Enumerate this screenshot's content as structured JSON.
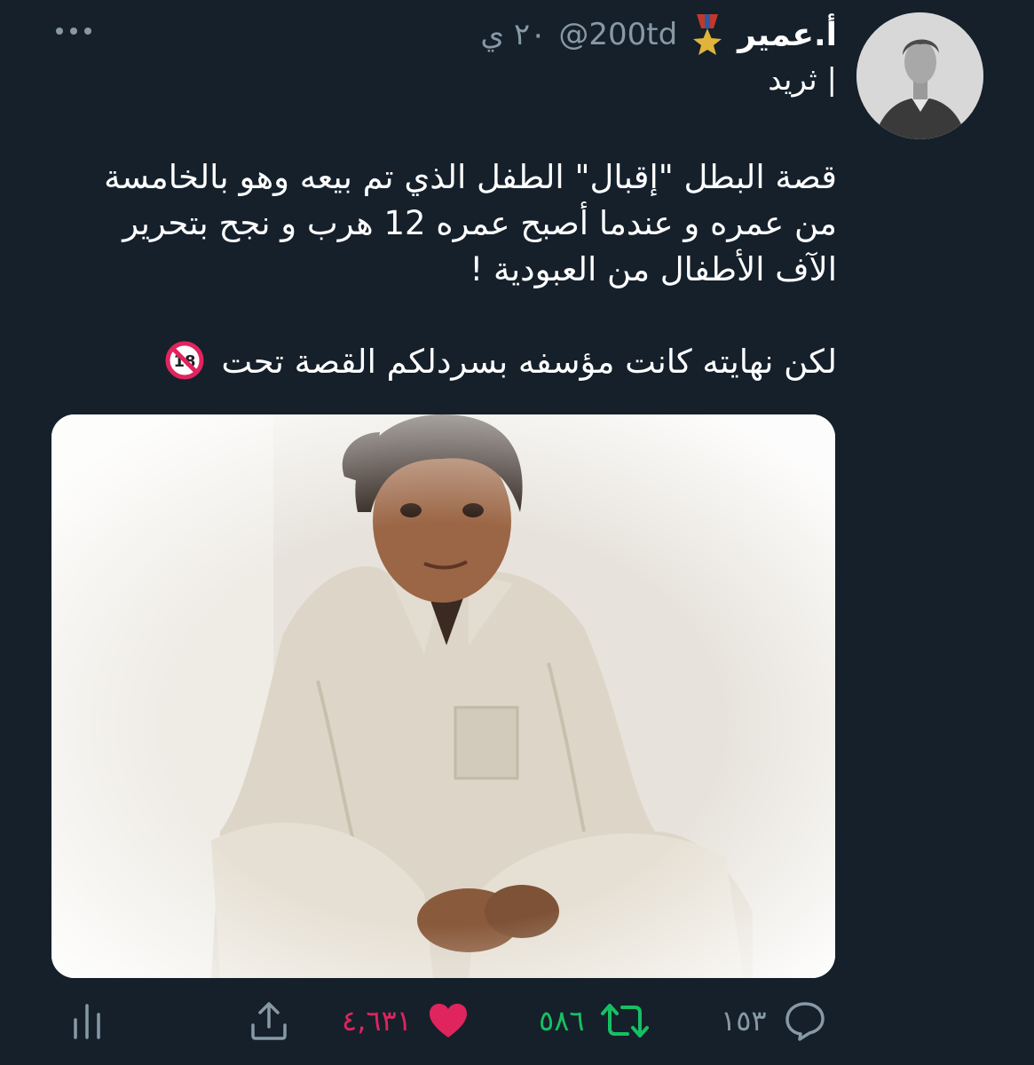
{
  "tweet": {
    "display_name": "أ.عمير",
    "handle": "@200td",
    "time": "٢٠ ي",
    "thread_label": "ثريد |",
    "body": {
      "line1": "قصة البطل \"إقبال\" الطفل الذي تم بيعه وهو بالخامسة",
      "line2": "من عمره و عندما أصبح عمره 12 هرب و نجح بتحرير",
      "line3": "الآف الأطفال من العبودية !",
      "line4": "لكن نهايته كانت مؤسفه بسردلكم القصة تحت"
    },
    "icons": {
      "medal": "military-medal-icon",
      "more": "more-dots-icon",
      "no18": "no-one-under-eighteen-icon",
      "reply": "reply-icon",
      "retweet": "retweet-icon",
      "like": "heart-icon",
      "share": "share-icon",
      "stats": "analytics-icon"
    },
    "actions": {
      "replies": "١٥٣",
      "retweets": "٥٨٦",
      "likes": "٤,٦٣١"
    },
    "colors": {
      "background": "#15202b",
      "secondary_text": "#8899a6",
      "retweet_green": "#17bf63",
      "like_pink": "#e0245e"
    }
  }
}
